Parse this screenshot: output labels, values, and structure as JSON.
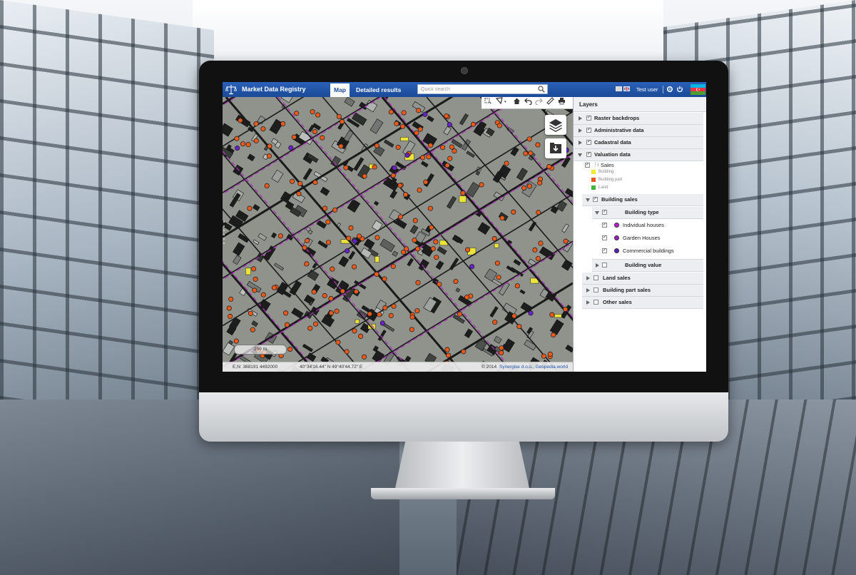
{
  "app": {
    "title": "Market Data Registry",
    "tabs": [
      {
        "label": "Map",
        "active": true
      },
      {
        "label": "Detailed results",
        "active": false
      }
    ],
    "search_placeholder": "Quick search",
    "user": "Test user",
    "accent_color": "#1b4a98"
  },
  "map": {
    "scale_label": "250 m",
    "coords_en": "E,N: 388191 4492000",
    "coords_geo": "40°34'16.44\" N 49°40'44.72\" E",
    "copyright_prefix": "© 2014",
    "copyright_link": "Synergise d.o.o., Geopedia.world",
    "toolbar_icons": [
      "select-icon",
      "measure-area-icon",
      "home-icon",
      "undo-icon",
      "redo-icon",
      "ruler-icon",
      "print-icon"
    ],
    "buttons": [
      "layers-icon",
      "download-icon"
    ],
    "marker_colors": {
      "sale": "#e8591c",
      "commercial": "#6b21c8",
      "building": "#e9e33a"
    }
  },
  "layers": {
    "title": "Layers",
    "top_groups": [
      {
        "label": "Raster backdrops",
        "checked": true,
        "expanded": false
      },
      {
        "label": "Administrative data",
        "checked": true,
        "expanded": false
      },
      {
        "label": "Cadastral data",
        "checked": true,
        "expanded": false
      },
      {
        "label": "Valuation data",
        "checked": true,
        "expanded": true
      }
    ],
    "sales": {
      "label": "Sales",
      "legend": [
        {
          "label": "Building",
          "color": "#f2ea2f"
        },
        {
          "label": "Building part",
          "color": "#e45a1c"
        },
        {
          "label": "Land",
          "color": "#3fb53a"
        }
      ]
    },
    "building_sales": {
      "label": "Building sales",
      "building_type": {
        "label": "Building type",
        "items": [
          {
            "label": "Individual houses",
            "color": "#c21bd6"
          },
          {
            "label": "Garden Houses",
            "color": "#a21cc4"
          },
          {
            "label": "Commercial buildings",
            "color": "#5a1bc4"
          }
        ]
      },
      "building_value": {
        "label": "Building value"
      }
    },
    "other_groups": [
      {
        "label": "Land sales",
        "checked": false
      },
      {
        "label": "Building part sales",
        "checked": false
      },
      {
        "label": "Other sales",
        "checked": false
      }
    ]
  }
}
